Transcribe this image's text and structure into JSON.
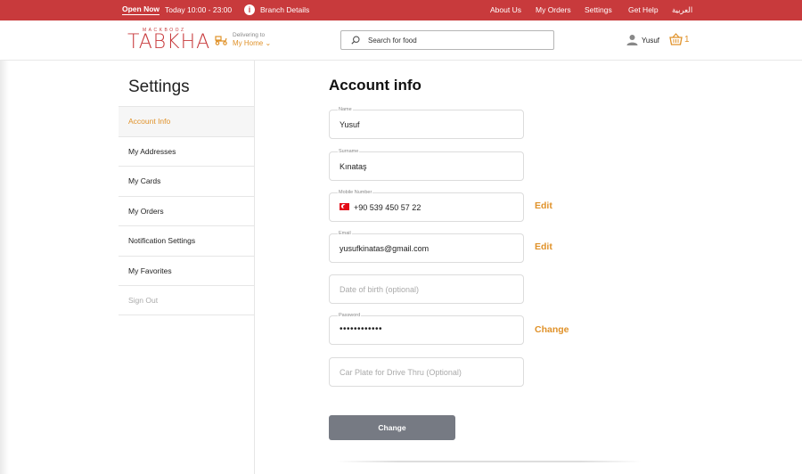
{
  "topbar": {
    "open_now": "Open Now",
    "hours": "Today 10:00 - 23:00",
    "branch_details": "Branch Details",
    "nav": [
      "About Us",
      "My Orders",
      "Settings",
      "Get Help",
      "العربية"
    ]
  },
  "header": {
    "logo_small": "MACKBOOZ",
    "logo": "TABKHA",
    "delivering_label": "Delivering to",
    "delivering_value": "My Home",
    "search_placeholder": "Search for food",
    "user_name": "Yusuf",
    "cart_count": "1"
  },
  "sidebar": {
    "title": "Settings",
    "items": [
      {
        "label": "Account Info",
        "state": "active"
      },
      {
        "label": "My Addresses",
        "state": "normal"
      },
      {
        "label": "My Cards",
        "state": "normal"
      },
      {
        "label": "My Orders",
        "state": "normal"
      },
      {
        "label": "Notification Settings",
        "state": "normal"
      },
      {
        "label": "My Favorites",
        "state": "normal"
      },
      {
        "label": "Sign Out",
        "state": "muted"
      }
    ]
  },
  "main": {
    "title": "Account info",
    "fields": {
      "name": {
        "label": "Name",
        "value": "Yusuf"
      },
      "surname": {
        "label": "Surname",
        "value": "Kınataş"
      },
      "mobile": {
        "label": "Mobile Number",
        "value": "+90 539 450 57 22",
        "action": "Edit"
      },
      "email": {
        "label": "Email",
        "value": "yusufkinatas@gmail.com",
        "action": "Edit"
      },
      "dob": {
        "placeholder": "Date of birth (optional)"
      },
      "password": {
        "label": "Password",
        "value": "••••••••••••",
        "action": "Change"
      },
      "car_plate": {
        "placeholder": "Car Plate for Drive Thru (Optional)"
      }
    },
    "submit_label": "Change"
  },
  "colors": {
    "brand_red": "#c83a3c",
    "accent_orange": "#e0922a",
    "button_gray": "#767a83"
  }
}
